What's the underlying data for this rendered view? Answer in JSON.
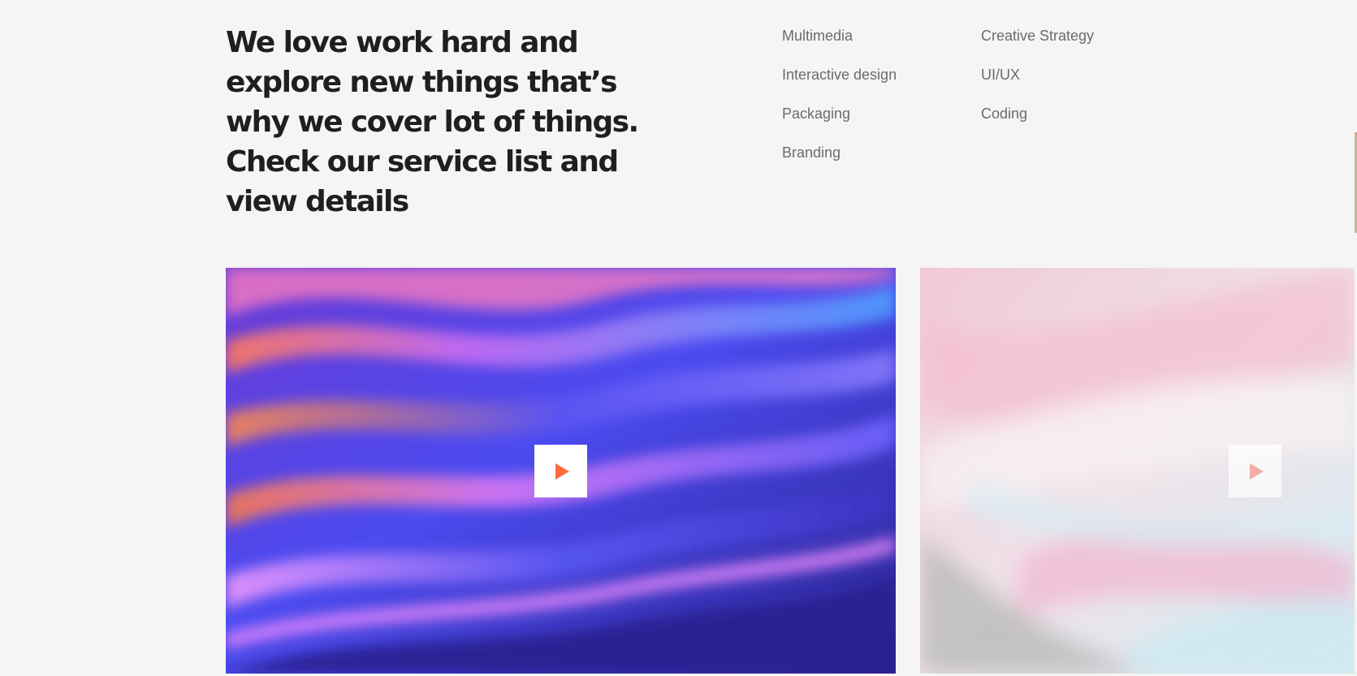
{
  "intro": {
    "heading": "We love work hard and explore new things that’s why we cover lot of things. Check our service list and view details"
  },
  "services": {
    "items": [
      {
        "label": "Multimedia"
      },
      {
        "label": "Creative Strategy"
      },
      {
        "label": "Interactive design"
      },
      {
        "label": "UI/UX"
      },
      {
        "label": "Packaging"
      },
      {
        "label": "Coding"
      },
      {
        "label": "Branding"
      }
    ]
  },
  "videos": [
    {
      "play_icon": "play-icon",
      "accent_color": "#ff6a3d"
    },
    {
      "play_icon": "play-icon",
      "accent_color": "#ef968c"
    }
  ],
  "colors": {
    "background": "#f5f5f5",
    "heading": "#1f1f1f",
    "service_text": "#6b6b6b",
    "scroll_indicator": "#c7b69c"
  }
}
